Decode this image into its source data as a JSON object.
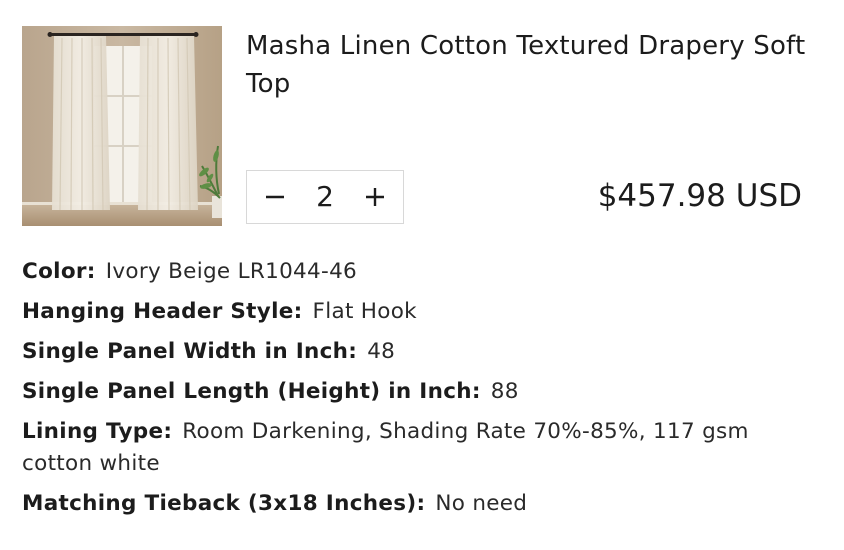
{
  "product": {
    "title": "Masha Linen Cotton Textured Drapery Soft Top",
    "image_icon": "curtain-product-photo"
  },
  "quantity": {
    "decrease_icon": "minus-icon",
    "value": "2",
    "increase_icon": "plus-icon"
  },
  "price": {
    "amount": "$457.98",
    "currency": "USD"
  },
  "specs": [
    {
      "label": "Color:",
      "value": "Ivory Beige LR1044-46"
    },
    {
      "label": "Hanging Header Style:",
      "value": "Flat Hook"
    },
    {
      "label": "Single Panel Width in Inch:",
      "value": "48"
    },
    {
      "label": "Single Panel Length (Height) in Inch:",
      "value": "88"
    },
    {
      "label": "Lining Type:",
      "value": "Room Darkening, Shading Rate 70%-85%, 117 gsm cotton white"
    },
    {
      "label": "Matching Tieback (3x18 Inches):",
      "value": "No need"
    }
  ]
}
